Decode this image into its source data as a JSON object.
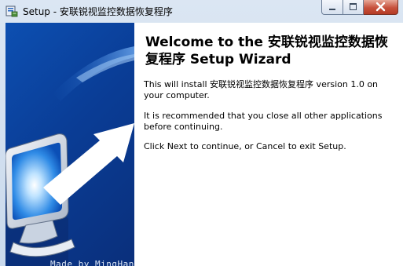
{
  "window": {
    "title": "Setup - 安联锐视监控数据恢复程序"
  },
  "wizard": {
    "heading": "Welcome to the 安联锐视监控数据恢复程序 Setup Wizard",
    "line1": "This will install 安联锐视监控数据恢复程序 version 1.0 on your computer.",
    "line2": "It is recommended that you close all other applications before continuing.",
    "line3": "Click Next to continue, or Cancel to exit Setup."
  },
  "side_panel": {
    "watermark": "Made by MingHan"
  },
  "icons": {
    "app": "setup-app-icon",
    "minimize": "minimize-icon",
    "maximize": "maximize-icon",
    "close": "close-icon",
    "artwork": "computer-monitor-arrow-icon"
  },
  "colors": {
    "side_panel": "#0a3d96",
    "close_button": "#c7513c"
  }
}
